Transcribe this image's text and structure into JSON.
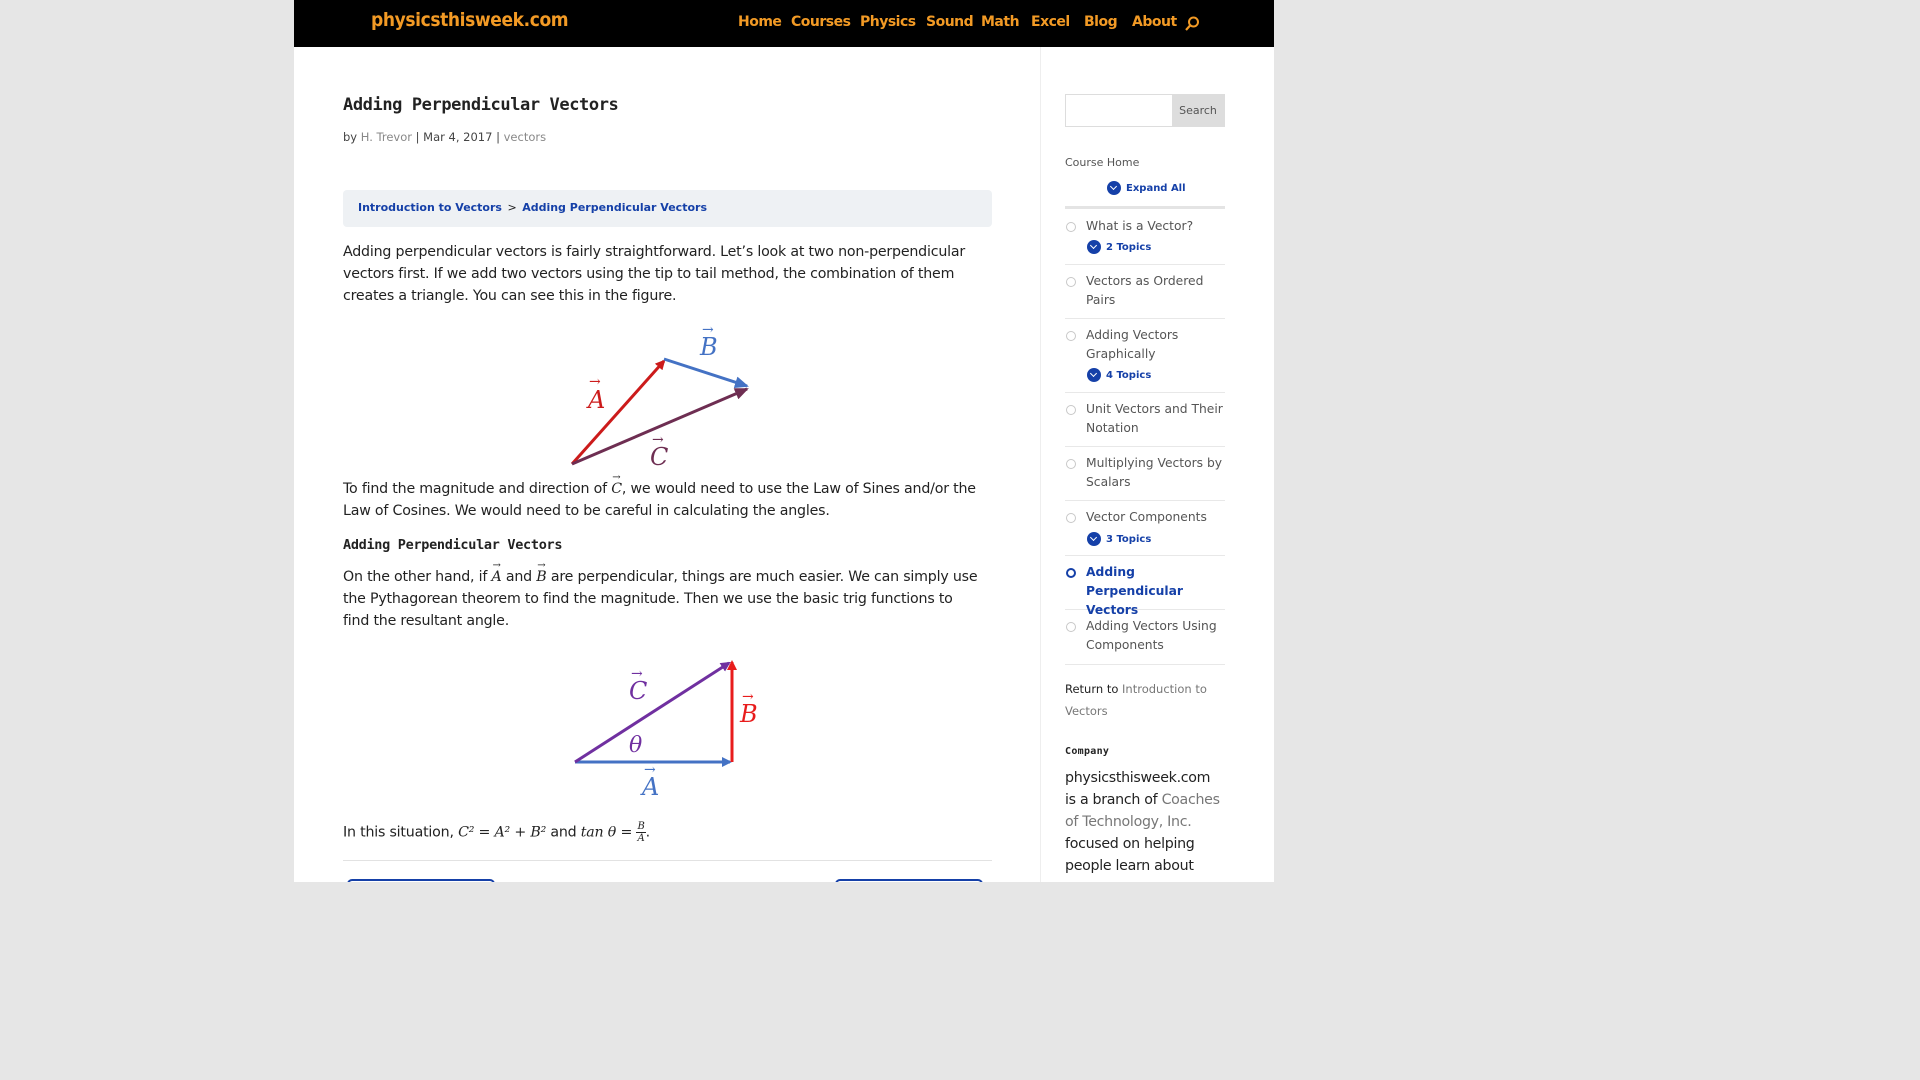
{
  "site": {
    "logo": "physicsthisweek.com",
    "nav": [
      "Home",
      "Courses",
      "Physics",
      "Sound",
      "Math",
      "Excel",
      "Blog",
      "About"
    ]
  },
  "post": {
    "title": "Adding Perpendicular Vectors",
    "meta": {
      "by": "by",
      "author": "H. Trevor",
      "sep": "|",
      "date": "Mar 4, 2017",
      "category": "vectors"
    },
    "breadcrumb": {
      "parent": "Introduction to Vectors",
      "sep": ">",
      "current": "Adding Perpendicular Vectors"
    },
    "p1": "Adding perpendicular vectors is fairly straightforward. Let’s look at two non-perpendicular vectors first.  If we add two vectors using the tip to tail method, the combination of them creates a triangle.  You can see this in the figure.",
    "fig1": {
      "label_a": "A",
      "label_b": "B",
      "label_c": "C",
      "colors": {
        "a": "#cc1b1b",
        "b": "#4472c4",
        "c": "#6e2e52"
      }
    },
    "p2": {
      "before": "To find the magnitude and direction of ",
      "var": "C",
      "after": ", we would need to use the Law of Sines and/or the Law of Cosines. We would need to be careful in calculating the angles."
    },
    "subheading": "Adding Perpendicular Vectors",
    "p3": {
      "t1": "On the other hand, if ",
      "var_a": "A",
      "t2": " and ",
      "var_b": "B",
      "t3": " are perpendicular, things are much easier.  We can simply use the Pythagorean theorem to find the magnitude. Then we use the basic trig functions to find the resultant angle."
    },
    "fig2": {
      "label_a": "A",
      "label_b": "B",
      "label_c": "C",
      "label_theta": "θ",
      "colors": {
        "a": "#4472c4",
        "b": "#e81c1c",
        "c": "#7030a0"
      }
    },
    "p4": {
      "before": "In this situation, ",
      "eq1": "C² = A² + B²",
      "mid": " and ",
      "eq2_pre": "tan θ = ",
      "frac_num": "B",
      "frac_den": "A",
      "end": "."
    }
  },
  "sidebar": {
    "search_button": "Search",
    "search_value": "",
    "course_home": "Course Home",
    "expand_all": "Expand All",
    "lessons": [
      {
        "title": "What is a Vector?",
        "topics": "2 Topics"
      },
      {
        "title": "Vectors as Ordered Pairs"
      },
      {
        "title": "Adding Vectors Graphically",
        "topics": "4 Topics"
      },
      {
        "title": "Unit Vectors and Their Notation"
      },
      {
        "title": "Multiplying Vectors by Scalars"
      },
      {
        "title": "Vector Components",
        "topics": "3 Topics"
      },
      {
        "title": "Adding Perpendicular Vectors",
        "active": true
      },
      {
        "title": "Adding Vectors Using Components"
      }
    ],
    "return_label": "Return to",
    "return_link": "Introduction to Vectors",
    "company_heading": "Company",
    "company_text_1": "physicsthisweek.com is a branch of ",
    "company_link": "Coaches of Technology, Inc.",
    "company_text_2": " focused on helping people learn about"
  },
  "colors": {
    "nav_orange": "#f29a25",
    "link_blue": "#1540a8",
    "header_bg": "#000000"
  }
}
